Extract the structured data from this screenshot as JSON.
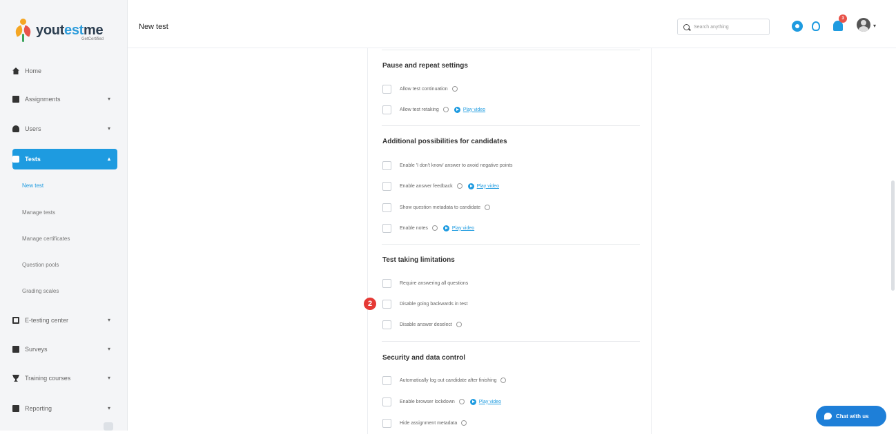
{
  "brand": {
    "name_part1": "yout",
    "name_accent": "est",
    "name_part2": "me",
    "subtitle": "GetCertified"
  },
  "header": {
    "title": "New test",
    "search_placeholder": "Search anything",
    "notifications_count": "3"
  },
  "sidebar": {
    "items": [
      {
        "label": "Home",
        "icon": "home-icon"
      },
      {
        "label": "Assignments",
        "icon": "grid-icon",
        "expandable": true
      },
      {
        "label": "Users",
        "icon": "users-icon",
        "expandable": true
      },
      {
        "label": "Tests",
        "icon": "tests-icon",
        "expandable": true,
        "active": true
      },
      {
        "label": "E-testing center",
        "icon": "testing-center-icon",
        "expandable": true
      },
      {
        "label": "Surveys",
        "icon": "surveys-icon",
        "expandable": true
      },
      {
        "label": "Training courses",
        "icon": "trophy-icon",
        "expandable": true
      },
      {
        "label": "Reporting",
        "icon": "reporting-icon",
        "expandable": true
      }
    ],
    "tests_subitems": [
      {
        "label": "New test",
        "current": true
      },
      {
        "label": "Manage tests"
      },
      {
        "label": "Manage certificates"
      },
      {
        "label": "Question pools"
      },
      {
        "label": "Grading scales"
      }
    ]
  },
  "sections": [
    {
      "title": "Pause and repeat settings",
      "options": [
        {
          "label": "Allow test continuation",
          "info": true,
          "checked": false
        },
        {
          "label": "Allow test retaking",
          "info": true,
          "play_video": "Play video",
          "checked": false
        }
      ]
    },
    {
      "title": "Additional possibilities for candidates",
      "options": [
        {
          "label": "Enable 'I don't know' answer to avoid negative points",
          "checked": false
        },
        {
          "label": "Enable answer feedback",
          "info": true,
          "play_video": "Play video",
          "checked": false
        },
        {
          "label": "Show question metadata to candidate",
          "info": true,
          "checked": false
        },
        {
          "label": "Enable notes",
          "info": true,
          "play_video": "Play video",
          "checked": false
        }
      ]
    },
    {
      "title": "Test taking limitations",
      "options": [
        {
          "label": "Require answering all questions",
          "checked": false
        },
        {
          "label": "Disable going backwards in test",
          "checked": false
        },
        {
          "label": "Disable answer deselect",
          "info": true,
          "checked": false
        }
      ]
    },
    {
      "title": "Security and data control",
      "options": [
        {
          "label": "Automatically log out candidate after finishing",
          "info": true,
          "checked": false
        },
        {
          "label": "Enable browser lockdown",
          "info": true,
          "play_video": "Play video",
          "checked": false
        },
        {
          "label": "Hide assignment metadata",
          "info": true,
          "checked": false
        }
      ]
    }
  ],
  "step_marker": "2",
  "chat": {
    "label": "Chat with us"
  }
}
